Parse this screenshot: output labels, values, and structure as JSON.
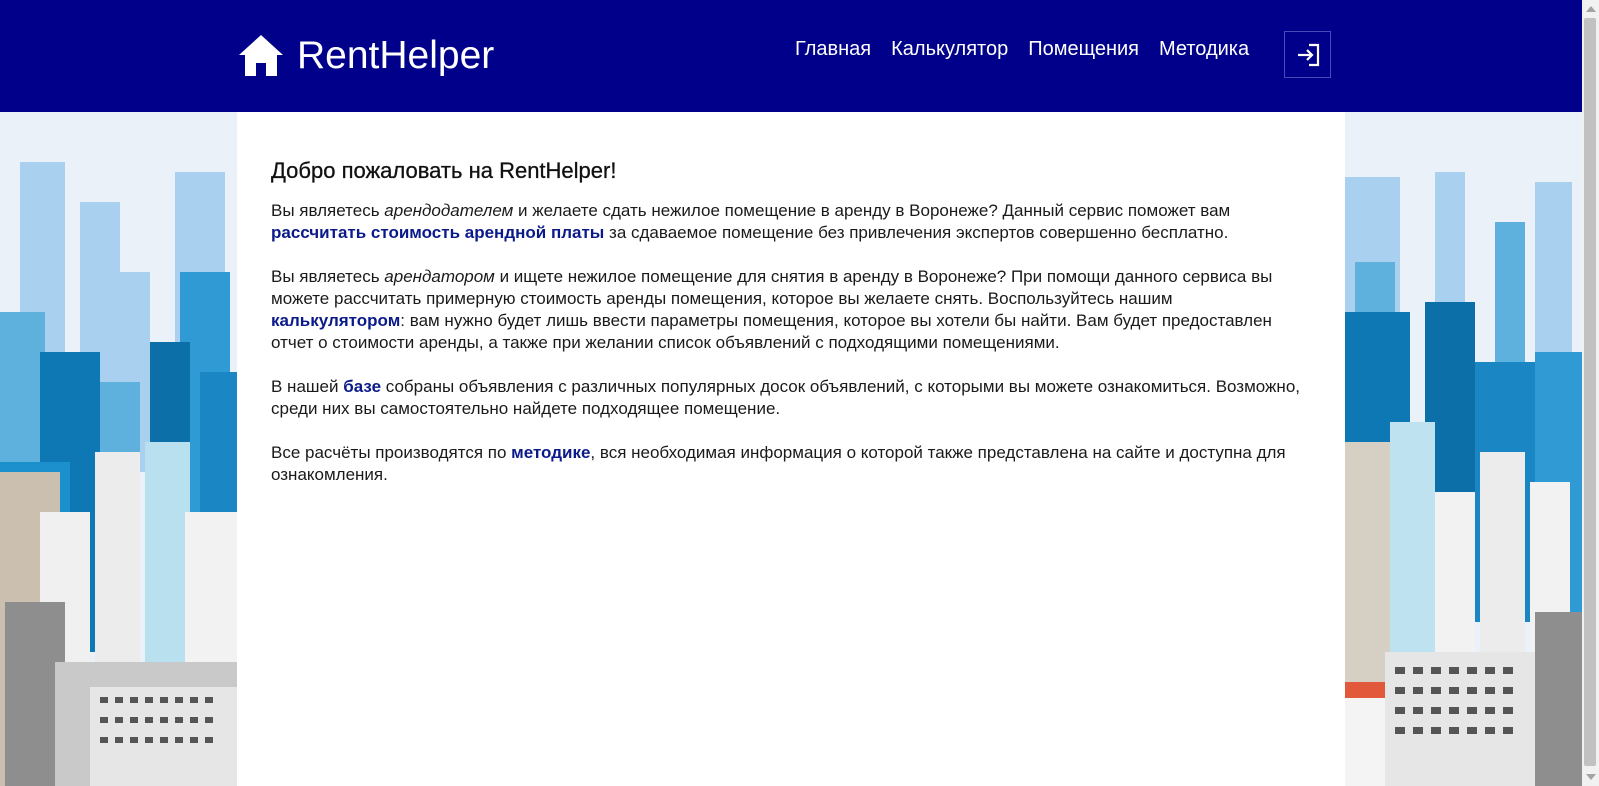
{
  "header": {
    "brand_name": "RentHelper",
    "nav": [
      {
        "label": "Главная"
      },
      {
        "label": "Калькулятор"
      },
      {
        "label": "Помещения"
      },
      {
        "label": "Методика"
      }
    ]
  },
  "main": {
    "title": "Добро пожаловать на RentHelper!",
    "p1": {
      "t1": "Вы являетесь ",
      "em": "арендодателем",
      "t2": " и желаете сдать нежилое помещение в аренду в Воронеже? Данный сервис поможет вам ",
      "link": "рассчитать стоимость арендной платы",
      "t3": " за сдаваемое помещение без привлечения экспертов совершенно бесплатно."
    },
    "p2": {
      "t1": "Вы являетесь ",
      "em": "арендатором",
      "t2": " и ищете нежилое помещение для снятия в аренду в Воронеже? При помощи данного сервиса вы можете рассчитать примерную стоимость аренды помещения, которое вы желаете снять. Воспользуйтесь нашим ",
      "link": "калькулятором",
      "t3": ": вам нужно будет лишь ввести параметры помещения, которое вы хотели бы найти. Вам будет предоставлен отчет о стоимости аренды, а также при желании список объявлений с подходящими помещениями."
    },
    "p3": {
      "t1": "В нашей ",
      "link": "базе",
      "t2": " собраны объявления с различных популярных досок объявлений, с которыми вы можете ознакомиться. Возможно, среди них вы самостоятельно найдете подходящее помещение."
    },
    "p4": {
      "t1": "Все расчёты производятся по ",
      "link": "методике",
      "t2": ", вся необходимая информация о которой также представлена на сайте и доступна для ознакомления."
    }
  },
  "colors": {
    "header_bg": "#00008b",
    "link": "#0a1a8a"
  },
  "icons": {
    "logo": "home-icon",
    "login": "login-icon"
  }
}
